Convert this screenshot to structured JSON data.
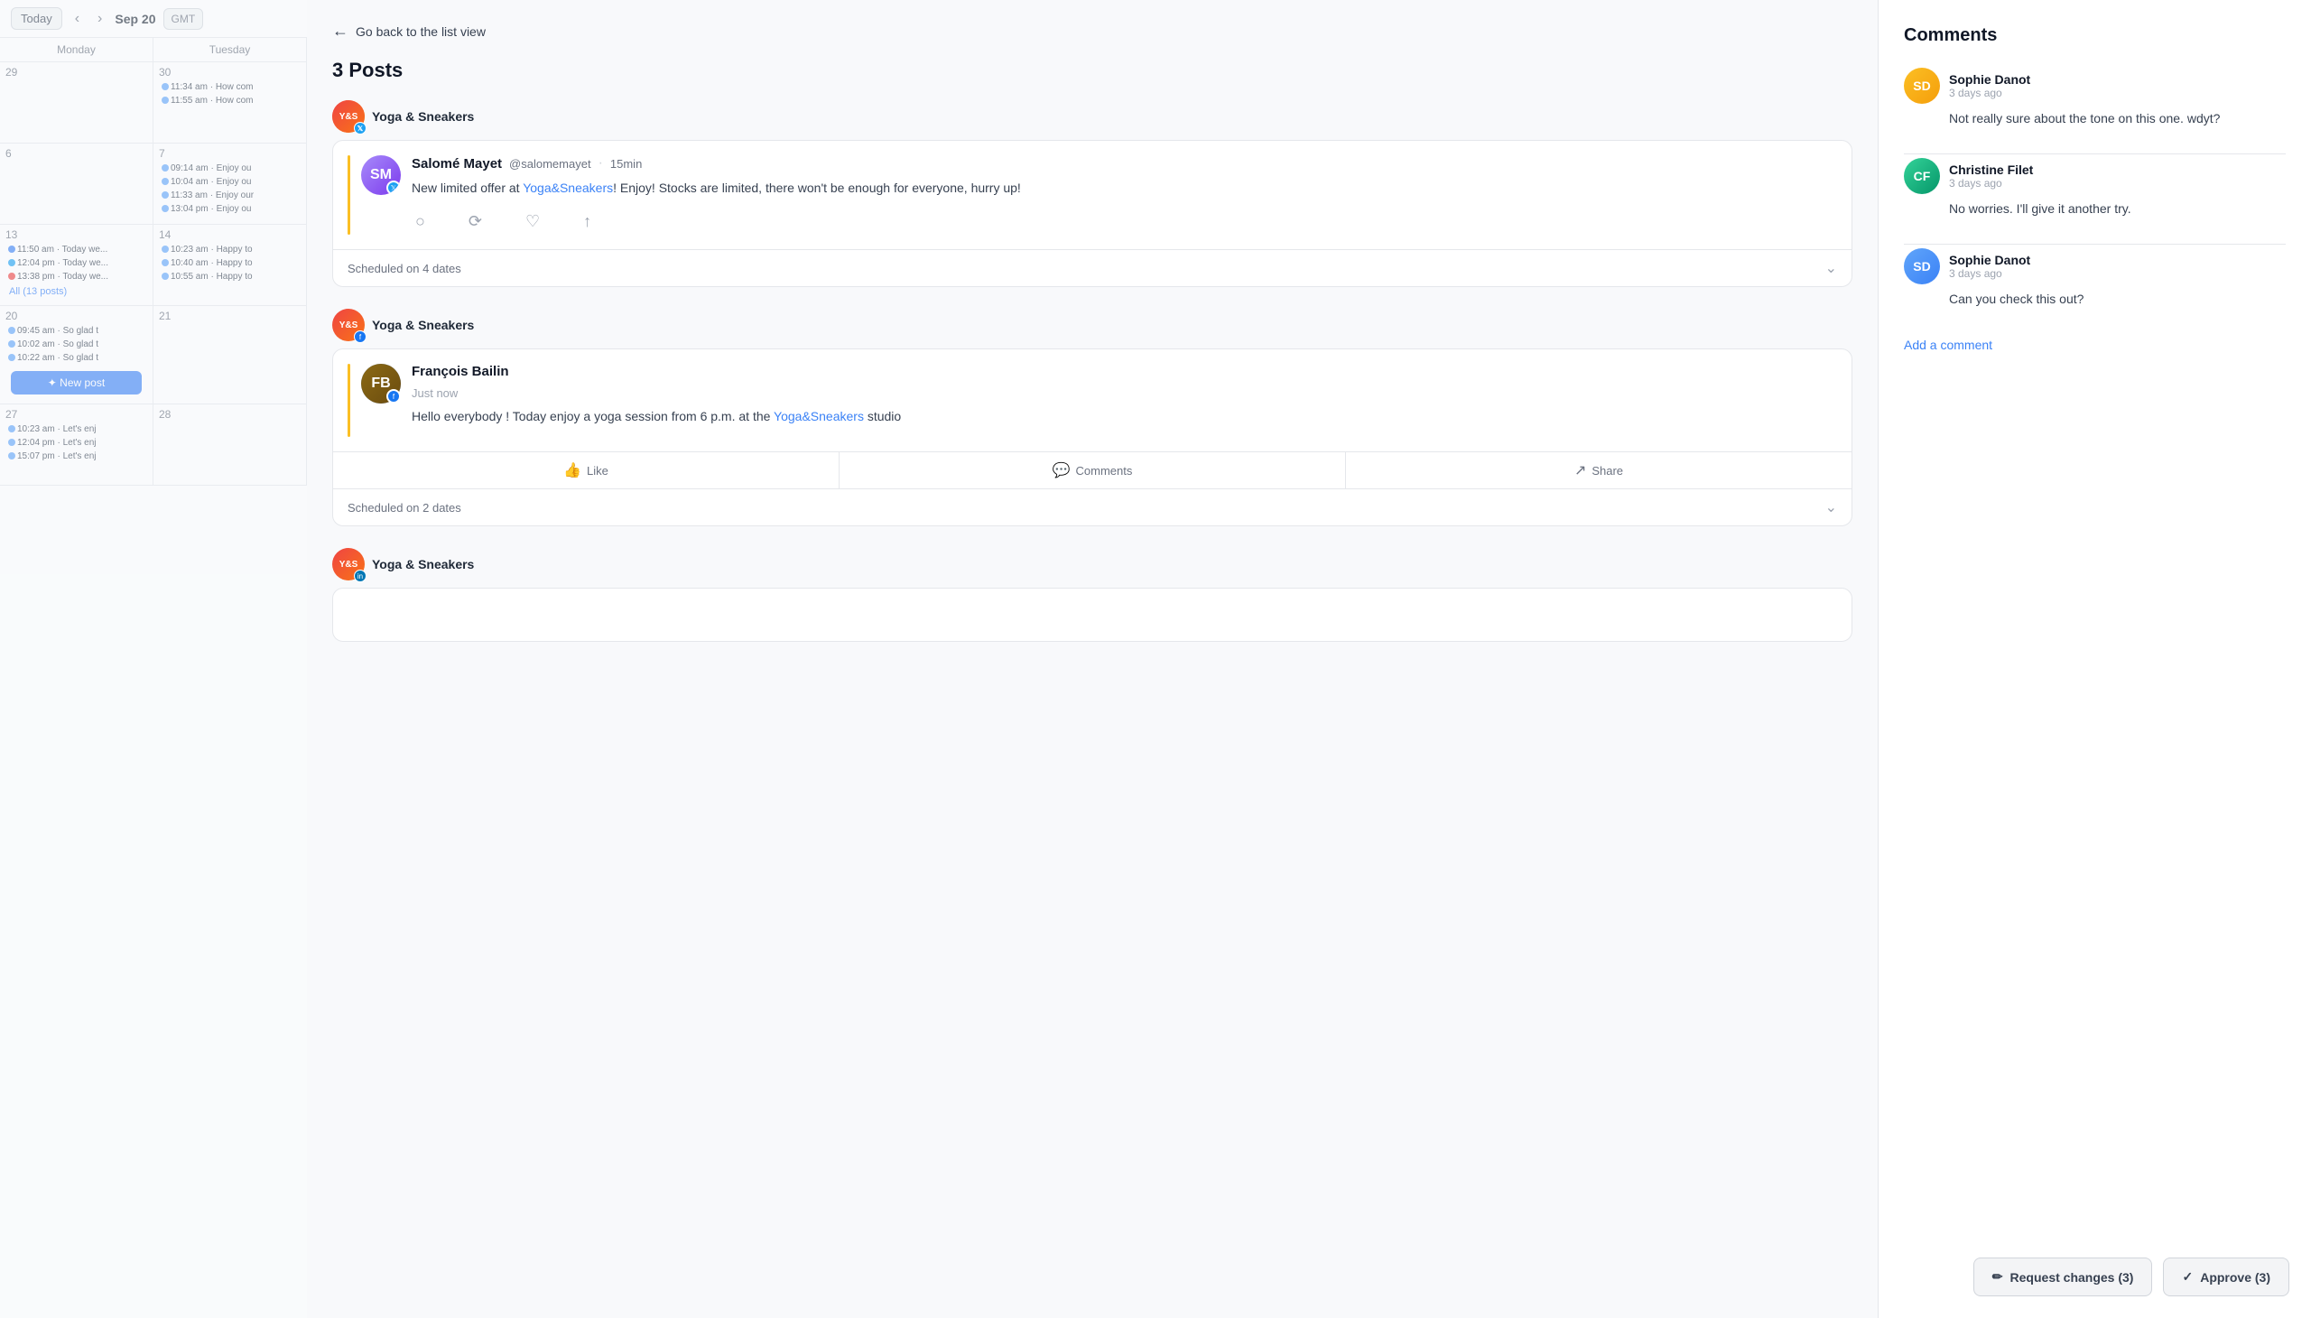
{
  "calendar": {
    "today_label": "Today",
    "date_label": "Sep 20",
    "tz_label": "GMT",
    "days": [
      "Monday",
      "Tuesday"
    ],
    "weeks": [
      {
        "cells": [
          {
            "num": "29",
            "events": []
          },
          {
            "num": "30",
            "events": [
              {
                "time": "11:34 am",
                "text": "How com"
              },
              {
                "time": "11:55 am",
                "text": "How com"
              }
            ]
          }
        ]
      },
      {
        "cells": [
          {
            "num": "6",
            "events": []
          },
          {
            "num": "7",
            "events": [
              {
                "time": "09:14 am",
                "text": "Enjoy ou"
              },
              {
                "time": "10:04 am",
                "text": "Enjoy ou"
              },
              {
                "time": "11:33 am",
                "text": "Enjoy our"
              },
              {
                "time": "13:04 pm",
                "text": "Enjoy ou"
              }
            ]
          }
        ]
      },
      {
        "cells": [
          {
            "num": "13",
            "events": [
              {
                "time": "11:50 am",
                "text": "Today we..."
              },
              {
                "time": "12:04 pm",
                "text": "Today we..."
              },
              {
                "time": "13:38 pm",
                "text": "Today we..."
              }
            ]
          },
          {
            "num": "14",
            "events": [
              {
                "time": "10:23 am",
                "text": "Happy to"
              },
              {
                "time": "10:40 am",
                "text": "Happy to"
              },
              {
                "time": "10:55 am",
                "text": "Happy to"
              }
            ]
          }
        ]
      },
      {
        "cells": [
          {
            "num": "20",
            "events": [
              {
                "time": "09:45 am",
                "text": "So glad t"
              },
              {
                "time": "10:02 am",
                "text": "So glad t"
              },
              {
                "time": "10:22 am",
                "text": "So glad t"
              }
            ]
          },
          {
            "num": "21",
            "events": []
          }
        ]
      },
      {
        "cells": [
          {
            "num": "27",
            "events": [
              {
                "time": "10:23 am",
                "text": "Let's enj"
              },
              {
                "time": "12:04 pm",
                "text": "Let's enj"
              },
              {
                "time": "15:07 pm",
                "text": "Let's enj"
              }
            ]
          },
          {
            "num": "28",
            "events": []
          }
        ]
      }
    ],
    "all_posts_label": "All (13 posts)",
    "new_post_label": "✦ New post"
  },
  "main": {
    "back_label": "Go back to the list view",
    "posts_count_label": "3 Posts",
    "brand_name": "Yoga & Sneakers",
    "posts": [
      {
        "id": "post-1",
        "social": "twitter",
        "author_name": "Salomé Mayet",
        "author_handle": "@salomemayet",
        "post_time": "15min",
        "post_text_before": "New limited offer at ",
        "post_link_text": "Yoga&Sneakers",
        "post_text_after": "! Enjoy! Stocks are limited, there won't be enough for everyone, hurry up!",
        "scheduled_label": "Scheduled on 4 dates",
        "actions": [
          "comment",
          "retweet",
          "like",
          "share"
        ]
      },
      {
        "id": "post-2",
        "social": "facebook",
        "author_name": "François Bailin",
        "author_handle": "",
        "post_time": "Just now",
        "post_text_before": "Hello everybody ! Today enjoy a yoga session from 6 p.m. at the ",
        "post_link_text": "Yoga&Sneakers",
        "post_text_after": " studio",
        "scheduled_label": "Scheduled on 2 dates",
        "fb_actions": [
          "Like",
          "Comments",
          "Share"
        ]
      },
      {
        "id": "post-3",
        "social": "linkedin",
        "author_name": "",
        "post_time": "",
        "post_text_before": "",
        "post_link_text": "",
        "post_text_after": "",
        "scheduled_label": ""
      }
    ]
  },
  "comments": {
    "title": "Comments",
    "items": [
      {
        "author": "Sophie Danot",
        "time": "3 days ago",
        "text": "Not really sure about the tone on this one. wdyt?"
      },
      {
        "author": "Christine Filet",
        "time": "3 days ago",
        "text": "No worries. I'll give it another try."
      },
      {
        "author": "Sophie Danot",
        "time": "3 days ago",
        "text": "Can you check this out?"
      }
    ],
    "add_comment_label": "Add a comment"
  },
  "actions": {
    "request_changes_label": "Request changes (3)",
    "approve_label": "Approve (3)"
  },
  "icons": {
    "back_arrow": "←",
    "comment": "💬",
    "retweet": "🔁",
    "like": "♡",
    "share": "↑",
    "like_fb": "👍",
    "comments_fb": "💬",
    "share_fb": "↗",
    "chevron_down": "⌄",
    "pencil": "✏",
    "check": "✓"
  }
}
